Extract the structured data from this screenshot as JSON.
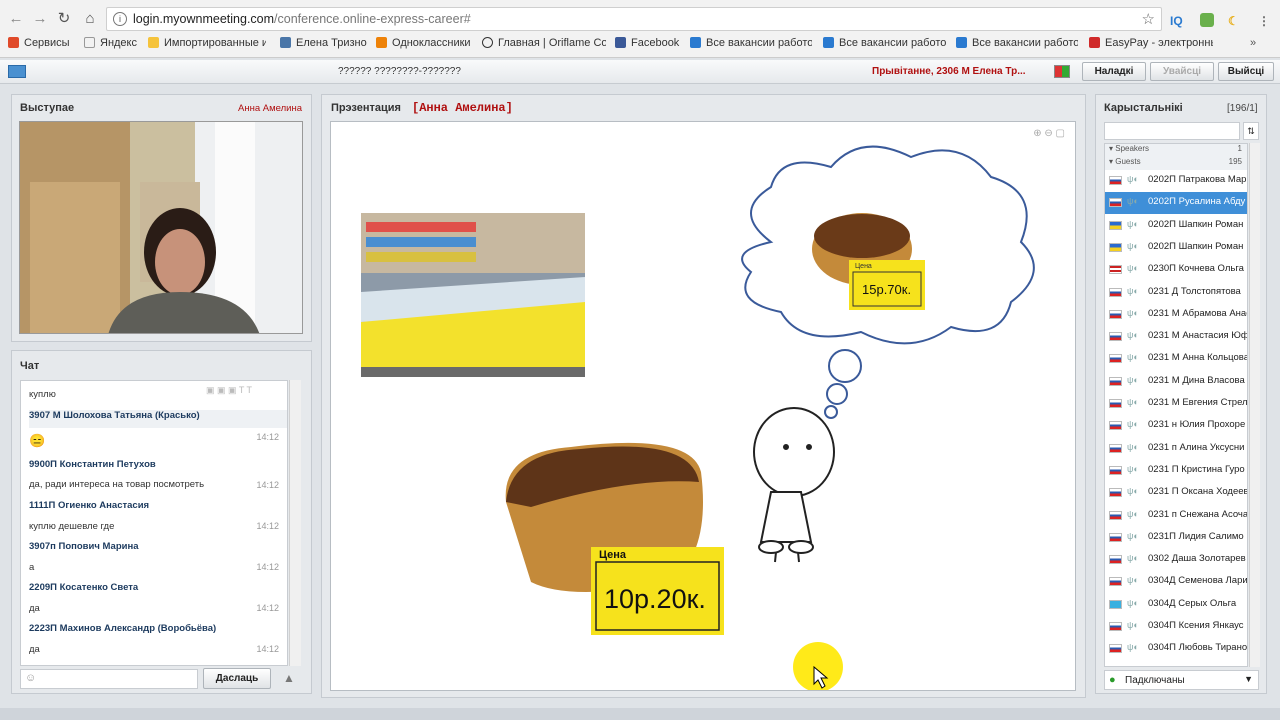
{
  "browser": {
    "url_host": "login.myownmeeting.com",
    "url_path": "/conference.online-express-career#",
    "extensions": [
      "IQ"
    ],
    "bookmarks": [
      {
        "label": "Сервисы",
        "color": "#e04a2a"
      },
      {
        "label": "Яндекс",
        "color": "#ffffff"
      },
      {
        "label": "Импортированные и",
        "color": "#f5c33b"
      },
      {
        "label": "Елена Тризно",
        "color": "#4a76a8"
      },
      {
        "label": "Одноклассники",
        "color": "#ee8208"
      },
      {
        "label": "Главная | Oriflame Co",
        "color": "#ffffff"
      },
      {
        "label": "Facebook",
        "color": "#3b5998"
      },
      {
        "label": "Все вакансии работо",
        "color": "#2a7ad0"
      },
      {
        "label": "Все вакансии работо",
        "color": "#2a7ad0"
      },
      {
        "label": "Все вакансии работо",
        "color": "#2a7ad0"
      },
      {
        "label": "EasyPay - электронны",
        "color": "#d02a2a"
      }
    ]
  },
  "app": {
    "title": "?????? ????????-???????",
    "greeting": "Прывітанне, 2306 М Елена Тр...",
    "buttons": {
      "settings": "Наладкі",
      "login": "Увайсці",
      "exit": "Выйсці"
    }
  },
  "speaker": {
    "title": "Выступае",
    "name": "Анна Амелина"
  },
  "chat": {
    "title": "Чат",
    "send": "Даслаць",
    "messages": [
      {
        "type": "text",
        "text": "куплю"
      },
      {
        "type": "name",
        "text": "3907 М Шолохова Татьяна (Красько)"
      },
      {
        "type": "emoji",
        "text": "😑",
        "time": "14:12"
      },
      {
        "type": "name",
        "text": "9900П Константин Петухов"
      },
      {
        "type": "text",
        "text": "да, ради интереса на товар посмотреть",
        "time": "14:12"
      },
      {
        "type": "name",
        "text": "1111П Огиенко Анастасия"
      },
      {
        "type": "text",
        "text": "куплю дешевле где",
        "time": "14:12"
      },
      {
        "type": "name",
        "text": "3907п Попович Марина"
      },
      {
        "type": "text",
        "text": "а",
        "time": "14:12"
      },
      {
        "type": "name",
        "text": "2209П Косатенко Света"
      },
      {
        "type": "text",
        "text": "да",
        "time": "14:12"
      },
      {
        "type": "name",
        "text": "2223П Махинов Александр (Воробьёва)"
      },
      {
        "type": "text",
        "text": "да",
        "time": "14:12"
      }
    ]
  },
  "presentation": {
    "title": "Прэзентация",
    "presenter": "[Анна Амелина]",
    "price_big_label": "Цена",
    "price_big": "10р.20к.",
    "price_small_label": "Цена",
    "price_small": "15р.70к."
  },
  "users": {
    "title": "Карыстальнікі",
    "count": "[196/1]",
    "groups": [
      {
        "label": "Speakers",
        "count": "1"
      },
      {
        "label": "Guests",
        "count": "195"
      }
    ],
    "list": [
      {
        "name": "0202П Патракова Мар",
        "flag": "ru"
      },
      {
        "name": "0202П Русалина Абду",
        "flag": "ru",
        "selected": true
      },
      {
        "name": "0202П Шапкин Роман",
        "flag": "ua"
      },
      {
        "name": "0202П Шапкин Роман",
        "flag": "ua"
      },
      {
        "name": "0230П Кочнева Ольга",
        "flag": "us"
      },
      {
        "name": "0231 Д Толстопятова",
        "flag": "ru"
      },
      {
        "name": "0231 М Абрамова Анас",
        "flag": "ru"
      },
      {
        "name": "0231 М Анастасия Юф",
        "flag": "ru"
      },
      {
        "name": "0231 М Анна Кольцова",
        "flag": "ru"
      },
      {
        "name": "0231 М Дина Власова",
        "flag": "ru"
      },
      {
        "name": "0231 М Евгения Стрел",
        "flag": "ru"
      },
      {
        "name": "0231 н Юлия Прохоре",
        "flag": "ru"
      },
      {
        "name": "0231 п Алина Уксусни",
        "flag": "ru"
      },
      {
        "name": "0231 П Кристина Гуро",
        "flag": "ru"
      },
      {
        "name": "0231 П Оксана Ходеев",
        "flag": "ru"
      },
      {
        "name": "0231 п Снежана Асоча",
        "flag": "ru"
      },
      {
        "name": "0231П Лидия Салимо",
        "flag": "ru"
      },
      {
        "name": "0302 Даша Золотарев",
        "flag": "ru"
      },
      {
        "name": "0304Д Семенова Лари",
        "flag": "ru"
      },
      {
        "name": "0304Д Серых Ольга",
        "flag": "kz"
      },
      {
        "name": "0304П Ксения Янкаус",
        "flag": "ru"
      },
      {
        "name": "0304П Любовь Тирано",
        "flag": "ru"
      }
    ],
    "status": "Падключаны"
  },
  "colors": {
    "accent_red": "#b01010",
    "selection": "#3f8fd8",
    "price_yellow": "#f6e21c"
  }
}
